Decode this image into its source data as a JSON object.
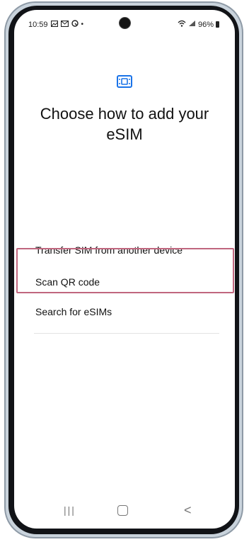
{
  "status_bar": {
    "time": "10:59",
    "battery_label": "96%",
    "icons": [
      "gallery-icon",
      "mail-icon",
      "vpn-icon",
      "dot-icon",
      "wifi-icon",
      "signal-icon",
      "battery-icon"
    ]
  },
  "page": {
    "icon": "sim-card-icon",
    "title": "Choose how to add your eSIM"
  },
  "options": [
    {
      "label": "Transfer SIM from another device"
    },
    {
      "label": "Scan QR code",
      "highlighted": true
    },
    {
      "label": "Search for eSIMs"
    }
  ],
  "nav": {
    "recents_glyph": "|||",
    "back_glyph": "<"
  },
  "colors": {
    "accent": "#1a73e8",
    "highlight": "#c0667e",
    "frame": "#c9d3dc"
  }
}
